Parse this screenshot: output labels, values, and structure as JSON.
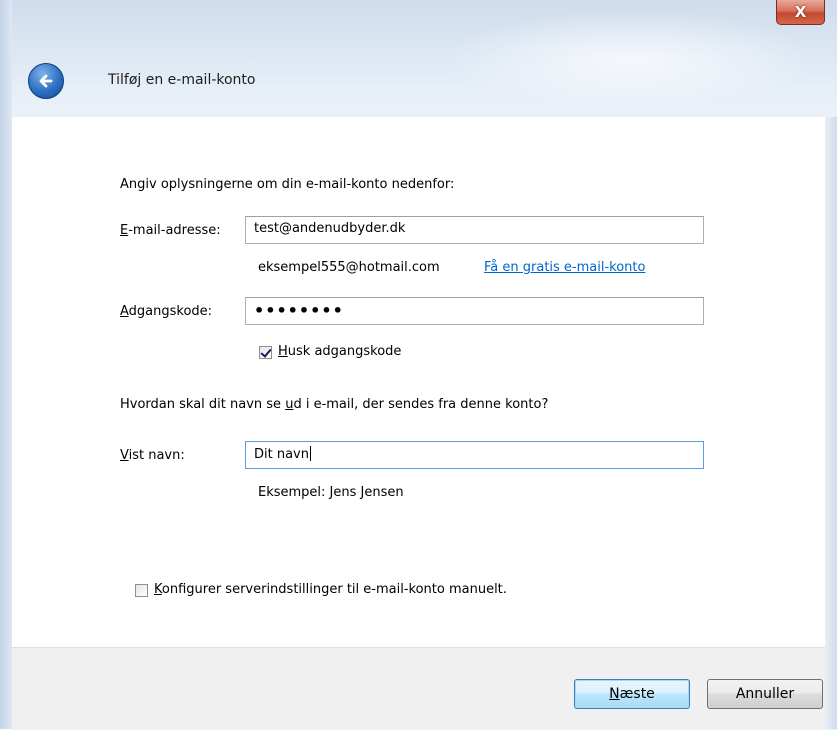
{
  "window": {
    "title": "Tilføj en e-mail-konto",
    "close_symbol": "X"
  },
  "form": {
    "intro": "Angiv oplysningerne om din e-mail-konto nedenfor:",
    "email": {
      "label_hotkey": "E",
      "label_rest": "-mail-adresse:",
      "value": "test@andenudbyder.dk",
      "example": "eksempel555@hotmail.com",
      "free_link": "Få en gratis e-mail-konto"
    },
    "password": {
      "label_hotkey": "A",
      "label_rest": "dgangskode:",
      "masked_value": "••••••••",
      "remember_hotkey": "H",
      "remember_rest": "usk adgangskode",
      "remember_checked": true
    },
    "name_question_pre": "Hvordan skal dit navn se ",
    "name_question_hotkey": "u",
    "name_question_post": "d i e-mail, der sendes fra denne konto?",
    "display_name": {
      "label_hotkey": "V",
      "label_rest": "ist navn:",
      "value": "Dit navn",
      "example": "Eksempel: Jens Jensen"
    },
    "manual": {
      "hotkey": "K",
      "rest": "onfigurer serverindstillinger til e-mail-konto manuelt.",
      "checked": false
    }
  },
  "footer": {
    "next_hotkey": "N",
    "next_rest": "æste",
    "cancel": "Annuller"
  },
  "icons": {
    "back": "back-arrow-icon",
    "close": "close-icon",
    "check": "checkmark-icon"
  },
  "colors": {
    "link": "#0066cc",
    "focus_border": "#569de5",
    "close_button": "#c14a30",
    "back_button": "#2c6fc4"
  }
}
